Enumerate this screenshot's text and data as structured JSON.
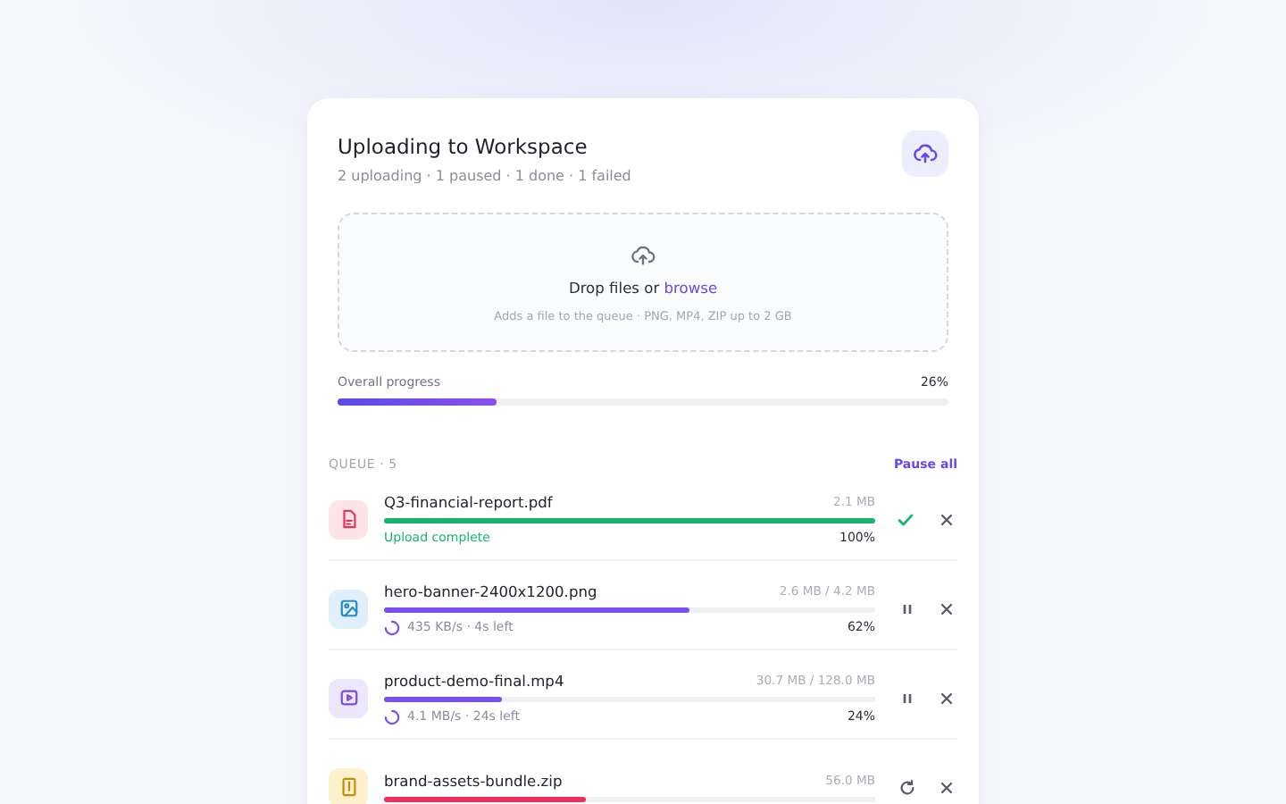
{
  "header": {
    "title": "Uploading to Workspace",
    "summary": "2 uploading · 1 paused · 1 done · 1 failed"
  },
  "dropzone": {
    "text": "Drop files or ",
    "link": "browse",
    "hint": "Adds a file to the queue · PNG, MP4, ZIP up to 2 GB"
  },
  "overall": {
    "label": "Overall progress",
    "reading": "26%",
    "level": 0.26
  },
  "queue": {
    "title": "QUEUE · 5",
    "action": "Pause all"
  },
  "files": [
    {
      "kind": "pdf",
      "complete": true,
      "failed": false,
      "name": "Q3-financial-report.pdf",
      "size": "2.1 MB",
      "level": 1,
      "status": "Upload complete",
      "percent": "100%"
    },
    {
      "kind": "image",
      "complete": false,
      "failed": false,
      "name": "hero-banner-2400x1200.png",
      "size": "2.6 MB / 4.2 MB",
      "level": 0.62,
      "rate": "435 KB/s · 4s left",
      "percent": "62%"
    },
    {
      "kind": "video",
      "complete": false,
      "failed": false,
      "name": "product-demo-final.mp4",
      "size": "30.7 MB / 128.0 MB",
      "level": 0.24,
      "rate": "4.1 MB/s · 24s left",
      "percent": "24%"
    },
    {
      "kind": "zip",
      "complete": false,
      "failed": true,
      "name": "brand-assets-bundle.zip",
      "size": "56.0 MB",
      "level": 0.41
    }
  ]
}
